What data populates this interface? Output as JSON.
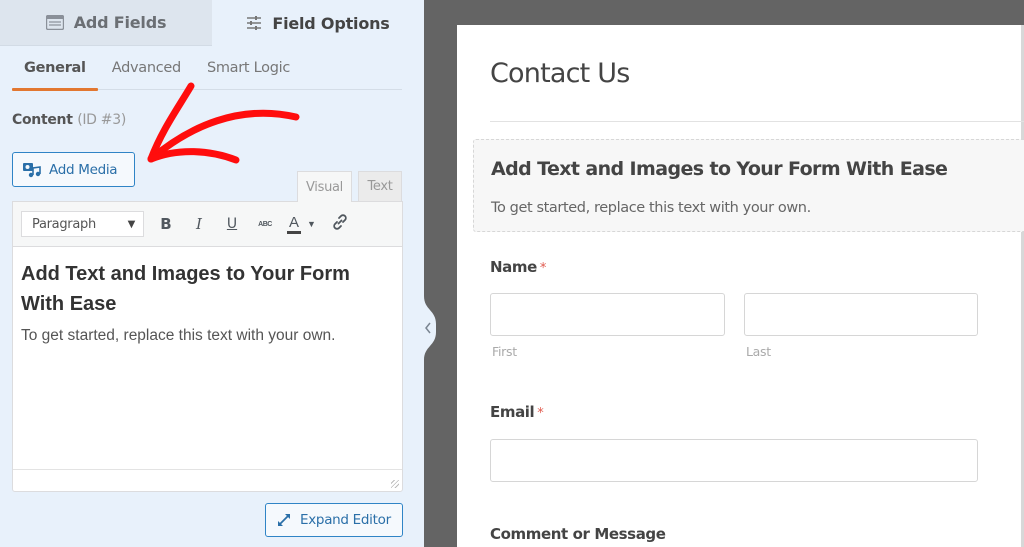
{
  "sidebar": {
    "top_tabs": [
      {
        "label": "Add Fields",
        "icon": "list-icon",
        "active": false
      },
      {
        "label": "Field Options",
        "icon": "sliders-icon",
        "active": true
      }
    ],
    "sub_tabs": [
      {
        "label": "General",
        "active": true
      },
      {
        "label": "Advanced",
        "active": false
      },
      {
        "label": "Smart Logic",
        "active": false
      }
    ],
    "content_label": "Content",
    "content_id": "(ID #3)",
    "add_media_label": "Add Media",
    "editor": {
      "tabs": [
        "Visual",
        "Text"
      ],
      "active_tab": "Visual",
      "format_select_value": "Paragraph",
      "toolbar": {
        "bold": "B",
        "italic": "I",
        "underline": "U",
        "strikethrough": "ABC",
        "text_color": "A"
      },
      "heading": "Add Text and Images to Your Form With Ease",
      "paragraph": "To get started, replace this text with your own."
    },
    "expand_editor_label": "Expand Editor"
  },
  "preview": {
    "form_title": "Contact Us",
    "content_block": {
      "heading": "Add Text and Images to Your Form With Ease",
      "paragraph": "To get started, replace this text with your own."
    },
    "fields": {
      "name": {
        "label": "Name",
        "required_mark": "*",
        "first_sublabel": "First",
        "last_sublabel": "Last",
        "first_value": "",
        "last_value": ""
      },
      "email": {
        "label": "Email",
        "required_mark": "*",
        "value": ""
      },
      "comment": {
        "label": "Comment or Message"
      }
    }
  },
  "annotation": {
    "color": "#ff0000",
    "points_to": "Add Media"
  },
  "colors": {
    "accent_orange": "#e27730",
    "button_blue": "#2f84c6",
    "sidebar_bg": "#e8f1fb",
    "preview_bg": "#646464",
    "required_red": "#e05a4e"
  }
}
